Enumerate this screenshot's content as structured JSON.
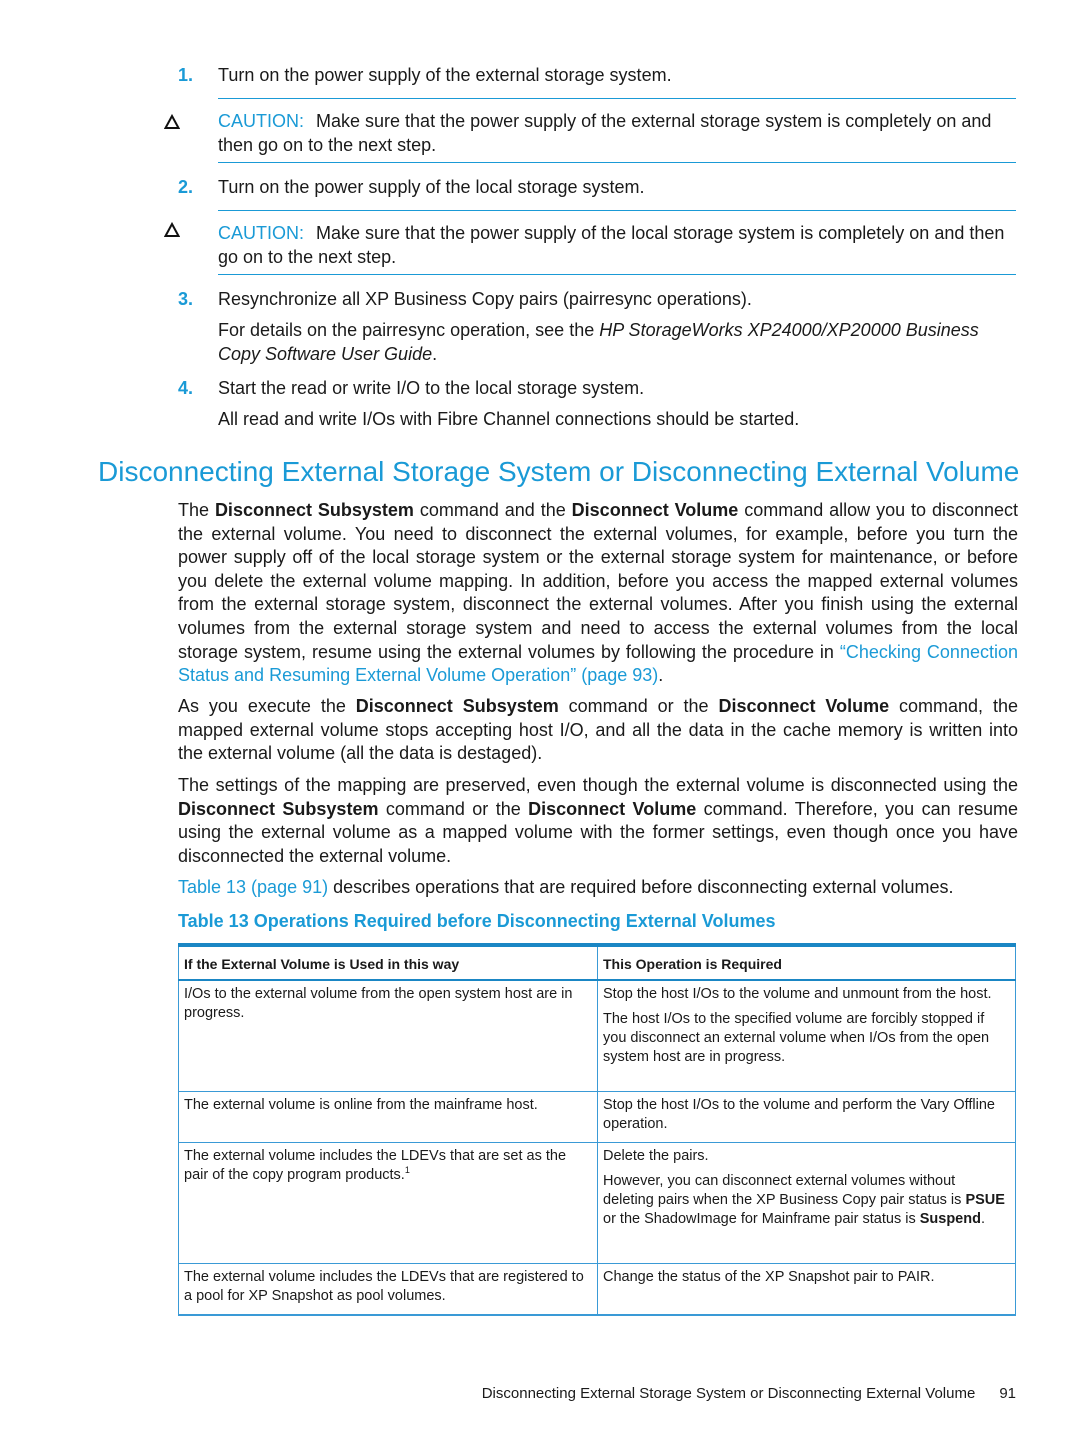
{
  "steps": [
    {
      "number": "1.",
      "text": "Turn on the power supply of the external storage system."
    },
    {
      "number": "2.",
      "text": "Turn on the power supply of the local storage system."
    },
    {
      "number": "3.",
      "text": "Resynchronize all XP Business Copy pairs (pairresync operations)."
    },
    {
      "number": "4.",
      "text": "Start the read or write I/O to the local storage system."
    }
  ],
  "cautions": [
    {
      "icon": "caution-triangle-icon",
      "label": "CAUTION:",
      "text": "Make sure that the power supply of the external storage system is completely on and then go on to the next step."
    },
    {
      "icon": "caution-triangle-icon",
      "label": "CAUTION:",
      "text": "Make sure that the power supply of the local storage system is completely on and then go on to the next step."
    }
  ],
  "step3_detail": {
    "prefix": "For details on the pairresync operation, see the ",
    "italic": "HP StorageWorks XP24000/XP20000 Business Copy Software User Guide",
    "suffix": "."
  },
  "step4_detail": "All read and write I/Os with Fibre Channel connections should be started.",
  "section_title": "Disconnecting External Storage System or Disconnecting External Volume",
  "paragraphs": {
    "p1": {
      "t1": "The ",
      "b1": "Disconnect Subsystem",
      "t2": " command and the ",
      "b2": "Disconnect Volume",
      "t3": " command allow you to disconnect the external volume. You need to disconnect the external volumes, for example, before you turn the power supply off of the local storage system or the external storage system for maintenance, or before you delete the external volume mapping. In addition, before you access the mapped external volumes from the external storage system, disconnect the external volumes. After you finish using the external volumes from the external storage system and need to access the external volumes from the local storage system, resume using the external volumes by following the procedure in ",
      "link": "“Checking Connection Status and Resuming External Volume Operation” (page 93)",
      "t4": "."
    },
    "p2": {
      "t1": "As you execute the ",
      "b1": "Disconnect Subsystem",
      "t2": " command or the ",
      "b2": "Disconnect Volume",
      "t3": " command, the mapped external volume stops accepting host I/O, and all the data in the cache memory is written into the external volume (all the data is destaged)."
    },
    "p3": {
      "t1": "The settings of the mapping are preserved, even though the external volume is disconnected using the ",
      "b1": "Disconnect Subsystem",
      "t2": " command or the ",
      "b2": "Disconnect Volume",
      "t3": " command. Therefore, you can resume using the external volume as a mapped volume with the former settings, even though once you have disconnected the external volume."
    },
    "p4": {
      "link": "Table 13 (page 91)",
      "t1": " describes operations that are required before disconnecting external volumes."
    }
  },
  "table": {
    "caption": "Table 13 Operations Required before Disconnecting External Volumes",
    "headers": [
      "If the External Volume is Used in this way",
      "This Operation is Required"
    ],
    "rows": [
      {
        "condition": "I/Os to the external volume from the open system host are in progress.",
        "operation": [
          "Stop the host I/Os to the volume and unmount from the host.",
          "The host I/Os to the specified volume are forcibly stopped if you disconnect an external volume when I/Os from the open system host are in progress."
        ]
      },
      {
        "condition": "The external volume is online from the mainframe host.",
        "operation": [
          "Stop the host I/Os to the volume and perform the Vary Offline operation."
        ]
      },
      {
        "condition": "The external volume includes the LDEVs that are set as the pair of the copy program products.",
        "footnote": "1",
        "operation": [
          "Delete the pairs."
        ],
        "operation_detail": {
          "t1": "However, you can disconnect external volumes without deleting pairs when the XP Business Copy pair status is ",
          "b1": "PSUE",
          "t2": " or the ShadowImage for Mainframe pair status is ",
          "b2": "Suspend",
          "t3": "."
        }
      },
      {
        "condition": "The external volume includes the LDEVs that are registered to a pool for XP Snapshot as pool volumes.",
        "operation": [
          "Change the status of the XP Snapshot pair to PAIR."
        ]
      }
    ]
  },
  "footer": {
    "title": "Disconnecting External Storage System or Disconnecting External Volume",
    "page": "91"
  }
}
